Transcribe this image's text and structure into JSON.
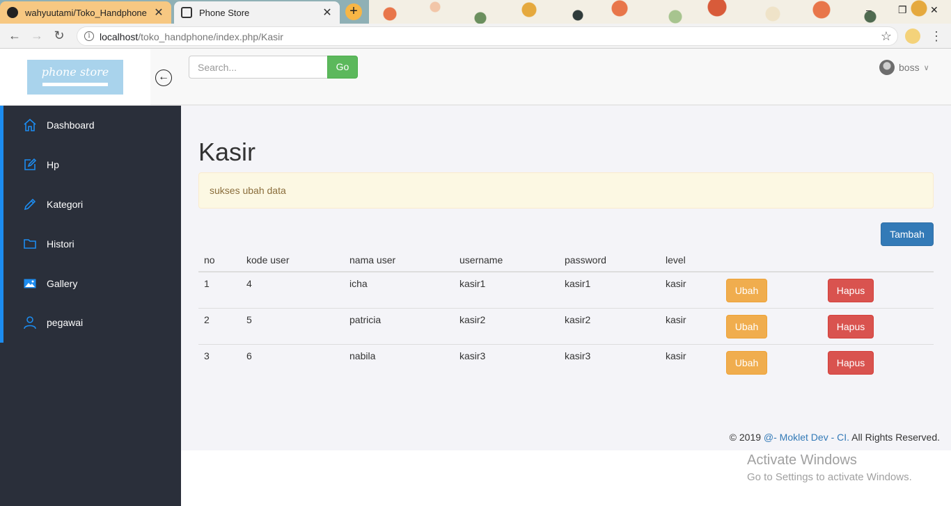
{
  "browser": {
    "tabs": [
      {
        "label": "wahyuutami/Toko_Handphone",
        "close": "✕"
      },
      {
        "label": "Phone Store",
        "close": "✕"
      }
    ],
    "new_tab": "+",
    "window_controls": {
      "minimize": "–",
      "restore": "❐",
      "close": "✕"
    },
    "url_host": "localhost",
    "url_path": "/toko_handphone/index.php/Kasir",
    "back": "←",
    "forward": "→",
    "reload": "↻",
    "star": "☆",
    "menu": "⋮",
    "info": "i"
  },
  "header": {
    "logo_text": "phone store",
    "toggle_icon": "←",
    "search_placeholder": "Search...",
    "search_button": "Go",
    "username": "boss",
    "user_chevron": "∨"
  },
  "sidebar": {
    "items": [
      {
        "label": "Dashboard",
        "icon": "home-icon"
      },
      {
        "label": "Hp",
        "icon": "edit-icon"
      },
      {
        "label": "Kategori",
        "icon": "pencil-icon"
      },
      {
        "label": "Histori",
        "icon": "folder-icon"
      },
      {
        "label": "Gallery",
        "icon": "image-icon"
      },
      {
        "label": "pegawai",
        "icon": "user-icon"
      }
    ]
  },
  "main": {
    "title": "Kasir",
    "alert": "sukses ubah data",
    "add_button": "Tambah",
    "table": {
      "headers": [
        "no",
        "kode user",
        "nama user",
        "username",
        "password",
        "level"
      ],
      "rows": [
        [
          "1",
          "4",
          "icha",
          "kasir1",
          "kasir1",
          "kasir"
        ],
        [
          "2",
          "5",
          "patricia",
          "kasir2",
          "kasir2",
          "kasir"
        ],
        [
          "3",
          "6",
          "nabila",
          "kasir3",
          "kasir3",
          "kasir"
        ]
      ],
      "edit_label": "Ubah",
      "delete_label": "Hapus"
    }
  },
  "footer": {
    "prefix": "© 2019",
    "link": "@- Moklet Dev - CI.",
    "suffix": "All Rights Reserved."
  },
  "watermark": {
    "line1": "Activate Windows",
    "line2": "Go to Settings to activate Windows."
  },
  "colors": {
    "sidebar_bg": "#2a2f3a",
    "sidebar_accent": "#1c8cf0",
    "go_button": "#5cb85c",
    "tambah_button": "#337ab7",
    "ubah_button": "#f0ad4e",
    "hapus_button": "#d9534f",
    "alert_bg": "#fcf8e3"
  }
}
